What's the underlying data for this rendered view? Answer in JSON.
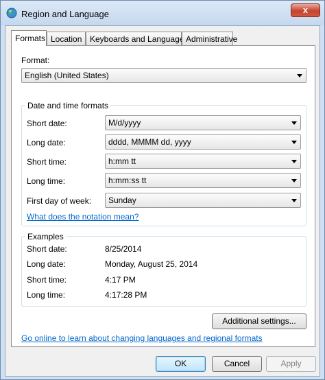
{
  "window": {
    "title": "Region and Language",
    "close_glyph": "x"
  },
  "tabs": [
    {
      "label": "Formats",
      "active": true
    },
    {
      "label": "Location",
      "active": false
    },
    {
      "label": "Keyboards and Languages",
      "active": false
    },
    {
      "label": "Administrative",
      "active": false
    }
  ],
  "format": {
    "label": "Format:",
    "value": "English (United States)"
  },
  "date_time_formats": {
    "title": "Date and time formats",
    "rows": [
      {
        "label": "Short date:",
        "value": "M/d/yyyy"
      },
      {
        "label": "Long date:",
        "value": "dddd, MMMM dd, yyyy"
      },
      {
        "label": "Short time:",
        "value": "h:mm tt"
      },
      {
        "label": "Long time:",
        "value": "h:mm:ss tt"
      },
      {
        "label": "First day of week:",
        "value": "Sunday"
      }
    ],
    "notation_link": "What does the notation mean?"
  },
  "examples": {
    "title": "Examples",
    "rows": [
      {
        "label": "Short date:",
        "value": "8/25/2014"
      },
      {
        "label": "Long date:",
        "value": "Monday, August 25, 2014"
      },
      {
        "label": "Short time:",
        "value": "4:17 PM"
      },
      {
        "label": "Long time:",
        "value": "4:17:28 PM"
      }
    ]
  },
  "additional_settings_label": "Additional settings...",
  "online_link": "Go online to learn about changing languages and regional formats",
  "buttons": {
    "ok": "OK",
    "cancel": "Cancel",
    "apply": "Apply"
  }
}
